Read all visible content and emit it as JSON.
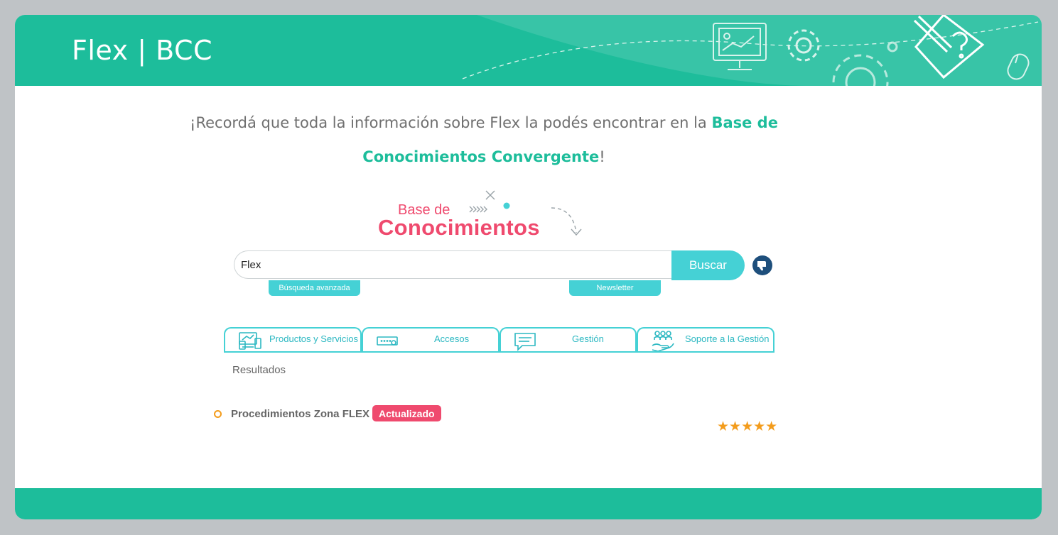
{
  "header": {
    "title": "Flex | BCC",
    "illustration": "Decorative line illustrations: monitor with chart, gears, mouse, hand writing a question mark"
  },
  "intro": {
    "text": "¡Recordá que toda la información sobre Flex la podés encontrar en la ",
    "highlight": "Base de Conocimientos Convergente",
    "suffix": "!"
  },
  "logo": {
    "line1": "Base de",
    "line2": "Conocimientos"
  },
  "search": {
    "value": "Flex",
    "button_label": "Buscar",
    "advanced_label": "Búsqueda avanzada",
    "newsletter_label": "Newsletter",
    "feedback_icon": "thumbs-down-icon"
  },
  "tabs": [
    {
      "label": "Productos y Servicios",
      "icon": "devices-icon"
    },
    {
      "label": "Accesos",
      "icon": "password-icon"
    },
    {
      "label": "Gestión",
      "icon": "chat-icon"
    },
    {
      "label": "Soporte a la Gestión",
      "icon": "support-hand-icon"
    }
  ],
  "results": {
    "label": "Resultados",
    "items": [
      {
        "title": "Procedimientos Zona FLEX",
        "badge": "Actualizado",
        "rating": "★★★★★"
      }
    ]
  },
  "colors": {
    "brand_green": "#1dbd9b",
    "accent_cyan": "#45d1d5",
    "logo_pink": "#ef4a6e",
    "star_orange": "#f39c1c"
  }
}
